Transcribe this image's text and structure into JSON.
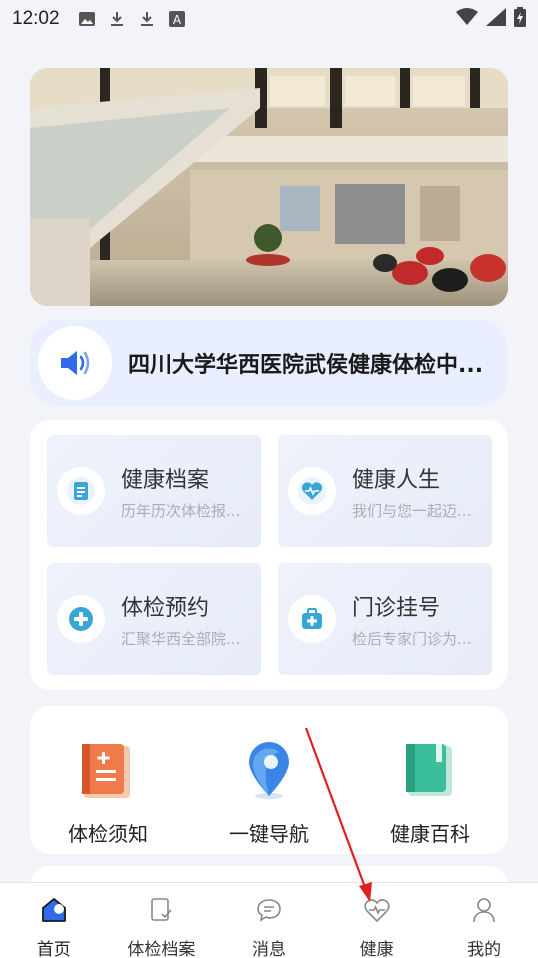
{
  "status_bar": {
    "time": "12:02",
    "icons": [
      "image-icon",
      "download-icon",
      "download-icon",
      "font-a-icon"
    ],
    "right_icons": [
      "wifi-icon",
      "signal-icon",
      "battery-icon"
    ]
  },
  "banner": {
    "alt": "hospital-lobby-photo"
  },
  "notice": {
    "text": "四川大学华西医院武侯健康体检中..."
  },
  "services": [
    {
      "title": "健康档案",
      "subtitle": "历年历次体检报...",
      "icon": "archive-icon"
    },
    {
      "title": "健康人生",
      "subtitle": "我们与您一起迈...",
      "icon": "heart-pulse-icon"
    },
    {
      "title": "体检预约",
      "subtitle": "汇聚华西全部院...",
      "icon": "plus-circle-icon"
    },
    {
      "title": "门诊挂号",
      "subtitle": "检后专家门诊为...",
      "icon": "medkit-icon"
    }
  ],
  "quick_links": [
    {
      "label": "体检须知",
      "icon": "notice-book-icon"
    },
    {
      "label": "一键导航",
      "icon": "location-pin-icon"
    },
    {
      "label": "健康百科",
      "icon": "encyclopedia-book-icon"
    }
  ],
  "tabbar": [
    {
      "label": "首页",
      "icon": "home-icon",
      "active": true
    },
    {
      "label": "体检档案",
      "icon": "record-icon",
      "active": false
    },
    {
      "label": "消息",
      "icon": "message-icon",
      "active": false
    },
    {
      "label": "健康",
      "icon": "health-icon",
      "active": false
    },
    {
      "label": "我的",
      "icon": "user-icon",
      "active": false
    }
  ],
  "colors": {
    "accent": "#2f6bea",
    "notice_bg": "#e9efff",
    "annotation": "#e02020"
  }
}
